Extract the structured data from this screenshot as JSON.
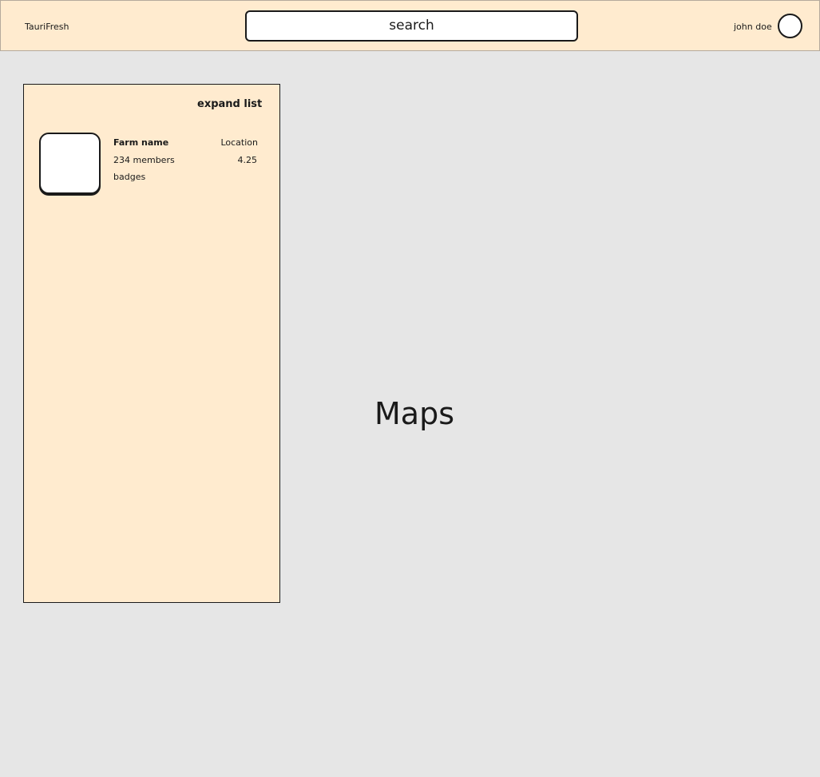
{
  "header": {
    "brand": "TauriFresh",
    "search_placeholder": "search",
    "username": "john doe"
  },
  "list": {
    "expand_label": "expand list",
    "items": [
      {
        "name": "Farm name",
        "members": "234 members",
        "badges": "badges",
        "location": "Location",
        "rating": "4.25"
      }
    ]
  },
  "map": {
    "label": "Maps"
  },
  "colors": {
    "background": "#e6e6e6",
    "panel": "#ffebcf",
    "border": "#1a1a1a"
  }
}
